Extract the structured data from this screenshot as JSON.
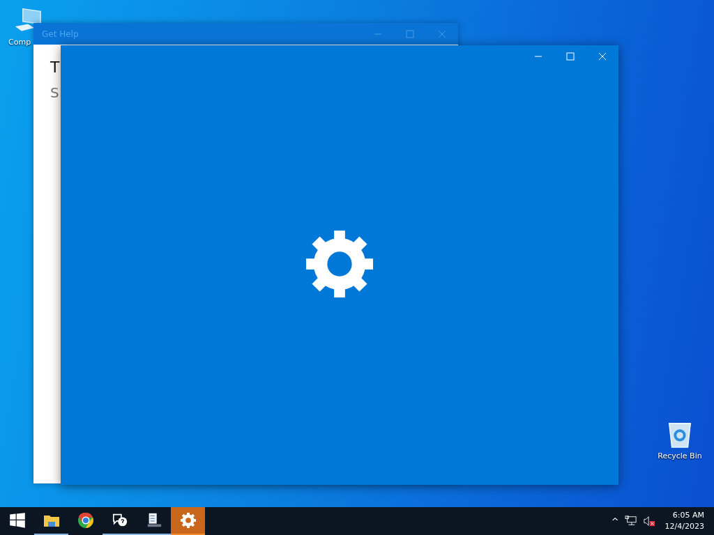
{
  "desktop_icons": [
    {
      "kind": "computer",
      "label": "Comp"
    },
    {
      "kind": "recycle-bin",
      "label": "Recycle Bin"
    }
  ],
  "help_window": {
    "title": "Get Help",
    "heading": "T",
    "subheading": "S"
  },
  "settings_window": {
    "kind": "loading"
  },
  "taskbar": {
    "items": [
      {
        "kind": "start",
        "running": false,
        "selected": false
      },
      {
        "kind": "folder",
        "running": true,
        "selected": false
      },
      {
        "kind": "browser",
        "running": false,
        "selected": false
      },
      {
        "kind": "help",
        "running": true,
        "selected": false
      },
      {
        "kind": "checklist",
        "running": true,
        "selected": false
      },
      {
        "kind": "settings",
        "running": true,
        "selected": true
      }
    ],
    "tray": {
      "chevron": "^",
      "volume_muted": true,
      "time": "6:05 AM",
      "date": "12/4/2023"
    }
  }
}
